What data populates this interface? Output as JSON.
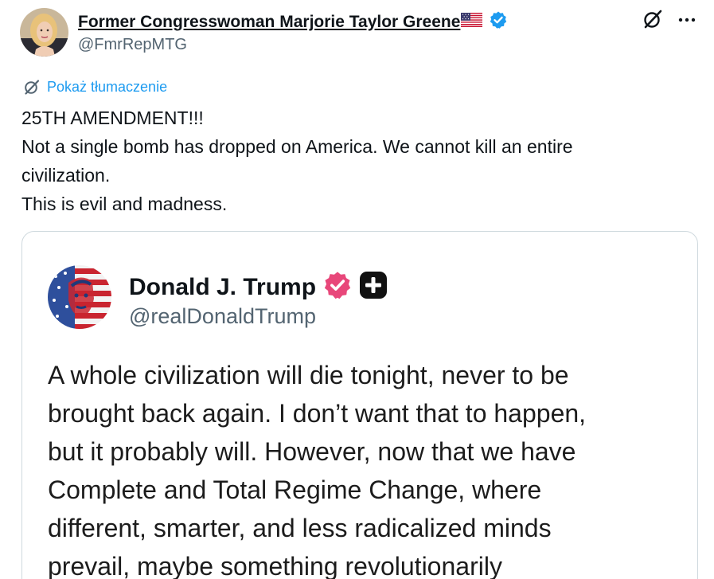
{
  "author": {
    "display_name": "Former Congresswoman Marjorie Taylor Greene",
    "handle": "@FmrRepMTG",
    "flag_icon": "us-flag-icon",
    "verified_icon": "verified-badge-icon",
    "verified_color": "#1d9bf0"
  },
  "actions": {
    "grok_icon": "grok-icon",
    "more_icon": "more-icon"
  },
  "translate": {
    "label": "Pokaż tłumaczenie",
    "icon": "translate-icon",
    "color": "#1d9bf0"
  },
  "tweet": {
    "lines": [
      "25TH AMENDMENT!!!",
      "Not a single bomb has dropped on America. We cannot kill an entire",
      "civilization.",
      "This is evil and madness."
    ]
  },
  "quote": {
    "display_name": "Donald J. Trump",
    "handle": "@realDonaldTrump",
    "badge_icon": "pink-verified-badge-icon",
    "badge_color": "#e8477a",
    "plus_icon": "plus-square-icon",
    "lines": [
      "A whole civilization will die tonight, never to be",
      "brought back again. I don’t want that to happen,",
      "but it probably will. However, now that we have",
      "Complete and Total Regime Change, where",
      "different, smarter, and less radicalized minds",
      "prevail, maybe something revolutionarily"
    ]
  },
  "colors": {
    "text": "#0f1419",
    "secondary": "#536471",
    "border": "#cfd9de"
  }
}
